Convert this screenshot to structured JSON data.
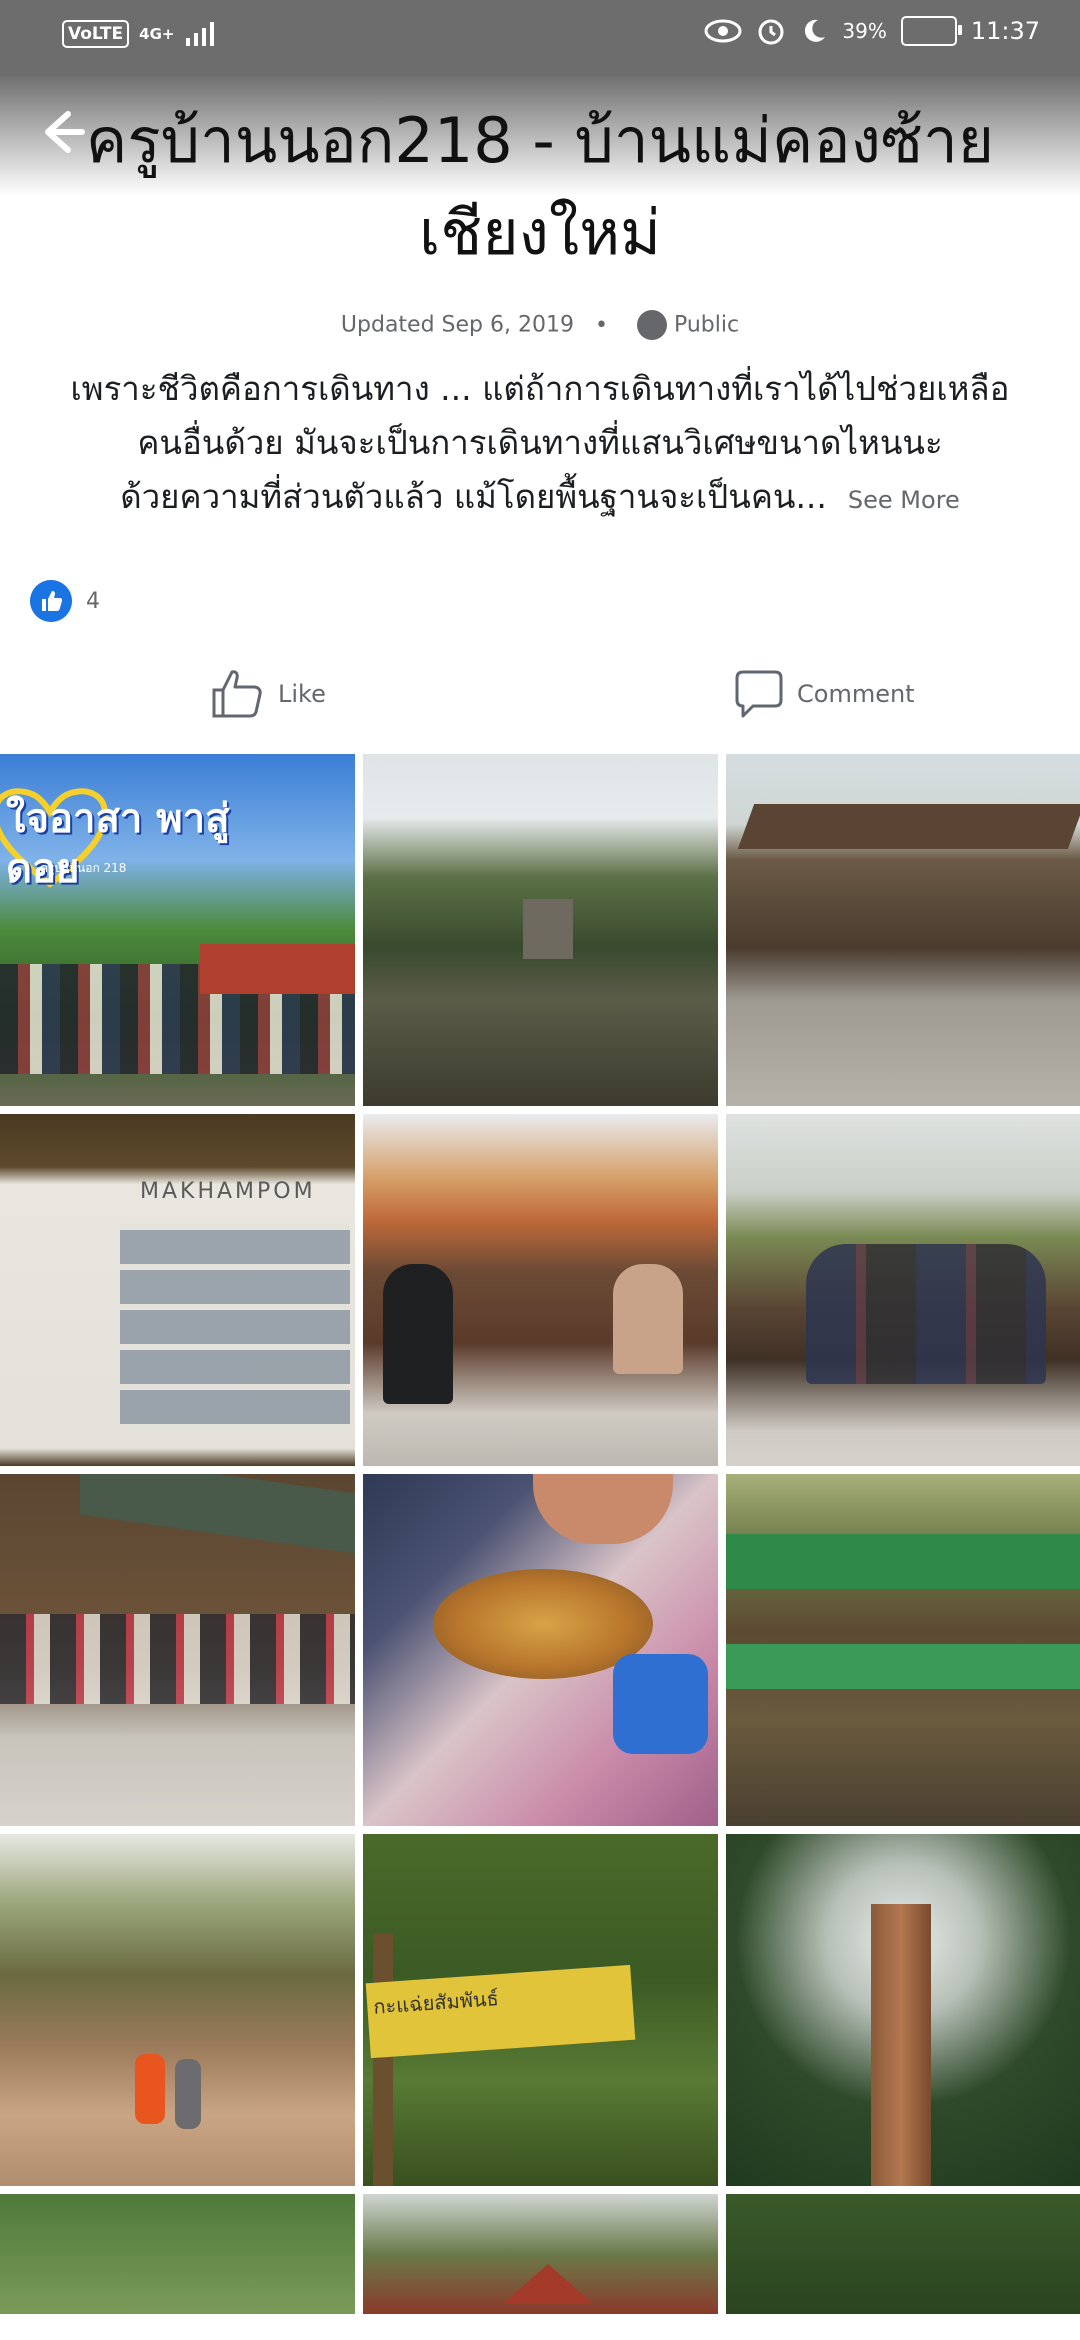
{
  "status_bar": {
    "network": "VoLTE",
    "signal": "4G+",
    "battery": "39%",
    "time": "11:37"
  },
  "header": {
    "back_label": "Back"
  },
  "album": {
    "title_line1": "ครูบ้านนอก218 - บ้านแม่คองซ้าย",
    "title_line2": "เชียงใหม่",
    "updated": "Updated Sep 6, 2019",
    "privacy": "Public",
    "description_line1": "เพราะชีวิตคือการเดินทาง ... แต่ถ้าการเดินทางที่เราได้ไปช่วยเหลือ",
    "description_line2": "คนอื่นด้วย มันจะเป็นการเดินทางที่แสนวิเศษขนาดไหนนะ",
    "description_line3": "ด้วยความที่ส่วนตัวแล้ว แม้โดยพื้นฐานจะเป็นคน...",
    "see_more": "See More",
    "like_count": "4"
  },
  "actions": {
    "like": "Like",
    "comment": "Comment"
  },
  "photos": {
    "p1_caption": "ใจอาสา พาสู่ดอย",
    "p1_small": "ครูบ้านนอก 218",
    "p4_caption": "MAKHAMPOM",
    "p11_caption": "กะแฉ่ยสัมพันธ์"
  }
}
